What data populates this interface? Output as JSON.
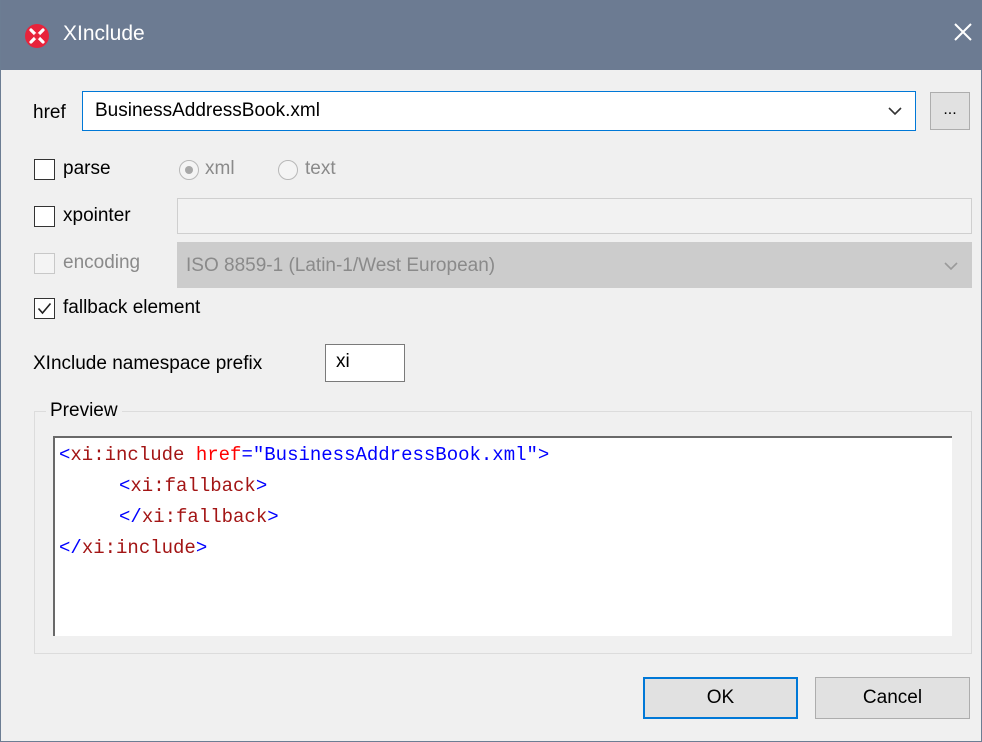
{
  "window": {
    "title": "XInclude"
  },
  "href": {
    "label": "href",
    "value": "BusinessAddressBook.xml",
    "browse_label": "..."
  },
  "parse": {
    "label": "parse",
    "checked": false,
    "options": [
      {
        "label": "xml",
        "selected": true
      },
      {
        "label": "text",
        "selected": false
      }
    ]
  },
  "xpointer": {
    "label": "xpointer",
    "checked": false,
    "value": ""
  },
  "encoding": {
    "label": "encoding",
    "checked": false,
    "enabled": false,
    "value": "ISO 8859-1 (Latin-1/West European)"
  },
  "fallback": {
    "label": "fallback element",
    "checked": true
  },
  "namespace_prefix": {
    "label": "XInclude namespace prefix",
    "value": "xi"
  },
  "preview": {
    "label": "Preview",
    "line1": {
      "open": "<",
      "tag": "xi:include",
      "attr": "href",
      "eq": "=",
      "value": "\"BusinessAddressBook.xml\"",
      "close": ">"
    },
    "line2": {
      "open": "<",
      "tag": "xi:fallback",
      "close": ">"
    },
    "line3": {
      "open": "</",
      "tag": "xi:fallback",
      "close": ">"
    },
    "line4": {
      "open": "</",
      "tag": "xi:include",
      "close": ">"
    }
  },
  "buttons": {
    "ok": "OK",
    "cancel": "Cancel"
  },
  "colors": {
    "titlebar": "#6c7b92",
    "focus_border": "#0078d7",
    "tag": "#0000ff",
    "element_name": "#a31515",
    "attribute": "#ff0000"
  },
  "icons": {
    "app": "xinclude-app-icon",
    "close": "close-icon",
    "dropdown": "chevron-down-icon",
    "check": "checkmark-icon"
  }
}
